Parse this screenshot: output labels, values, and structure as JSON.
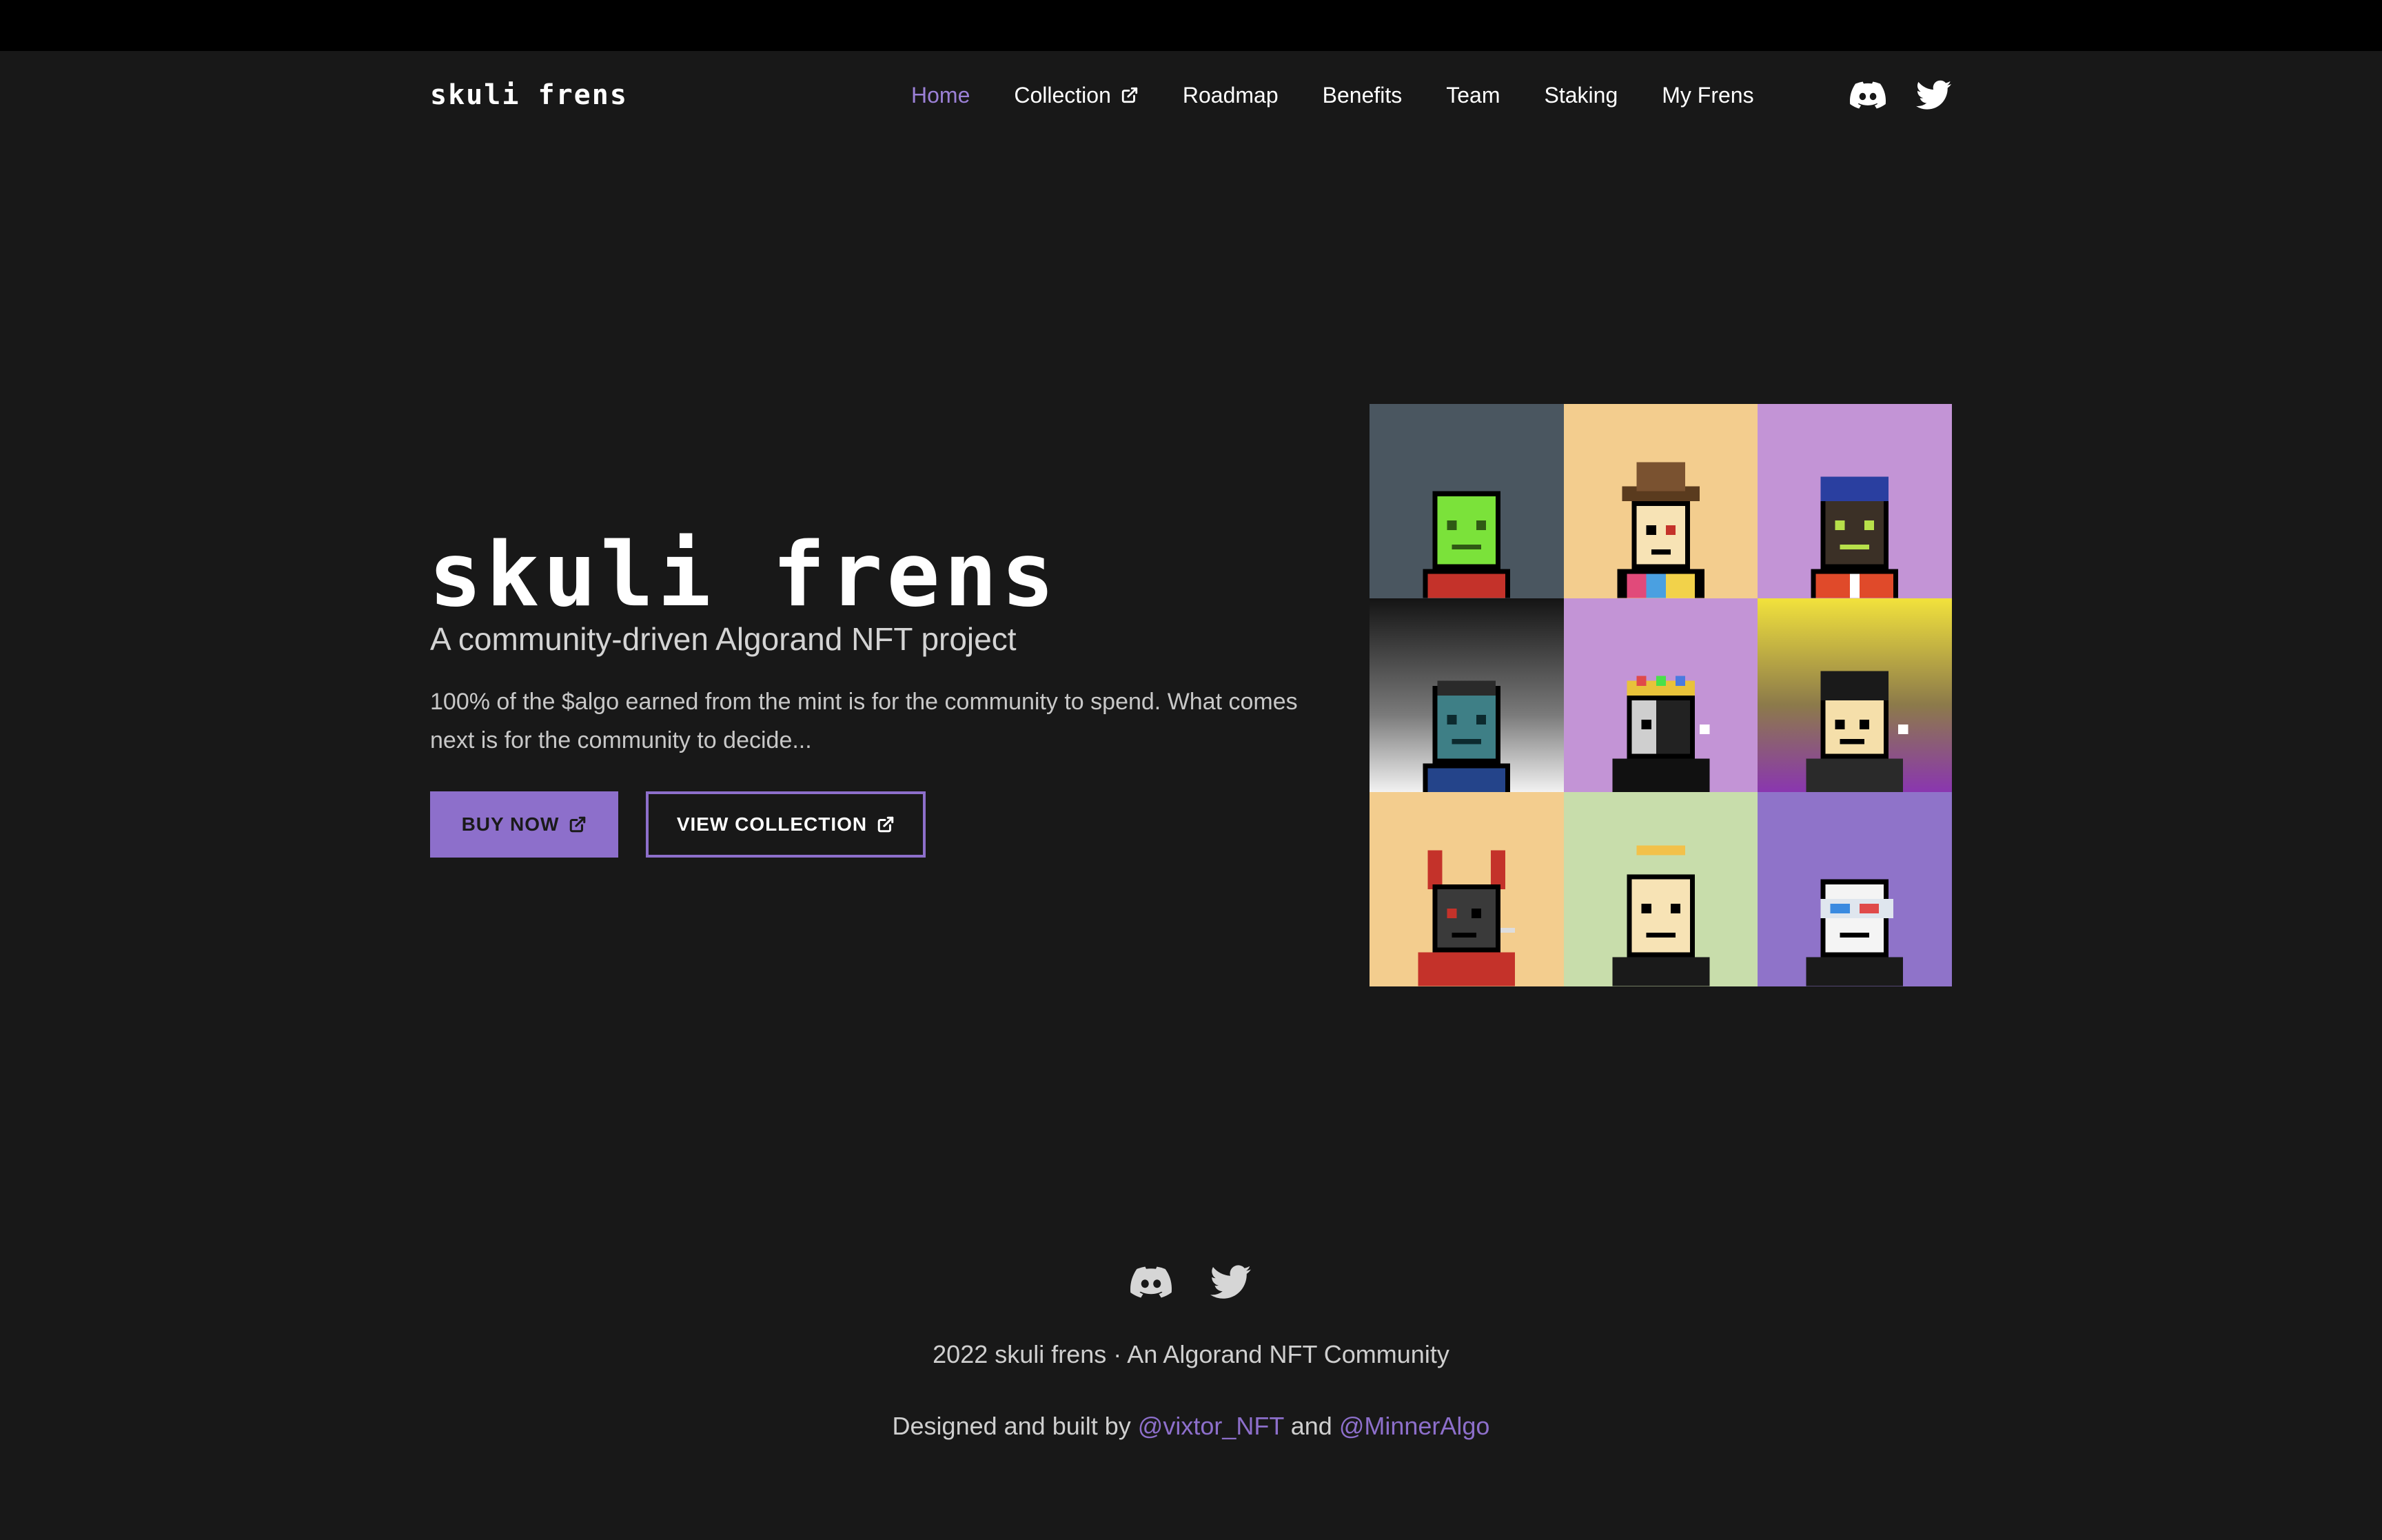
{
  "brand": {
    "name": "skuli frens"
  },
  "nav": {
    "items": [
      {
        "label": "Home"
      },
      {
        "label": "Collection"
      },
      {
        "label": "Roadmap"
      },
      {
        "label": "Benefits"
      },
      {
        "label": "Team"
      },
      {
        "label": "Staking"
      },
      {
        "label": "My Frens"
      }
    ],
    "social": [
      "discord-icon",
      "twitter-icon"
    ]
  },
  "hero": {
    "title": "skuli frens",
    "subtitle": "A community-driven Algorand NFT project",
    "description": "100% of the $algo earned from the mint is for the community to spend. What comes next is for the community to decide...",
    "buy_label": "BUY NOW",
    "view_label": "VIEW COLLECTION"
  },
  "footer": {
    "copyright": "2022 skuli frens · An Algorand NFT Community",
    "credits_prefix": "Designed and built by",
    "credit_1": "@vixtor_NFT",
    "credits_and": "and",
    "credit_2": "@MinnerAlgo"
  },
  "colors": {
    "background": "#181818",
    "accent": "#8d6fcb",
    "nav_active": "#9b80d6",
    "text": "#ffffff"
  }
}
